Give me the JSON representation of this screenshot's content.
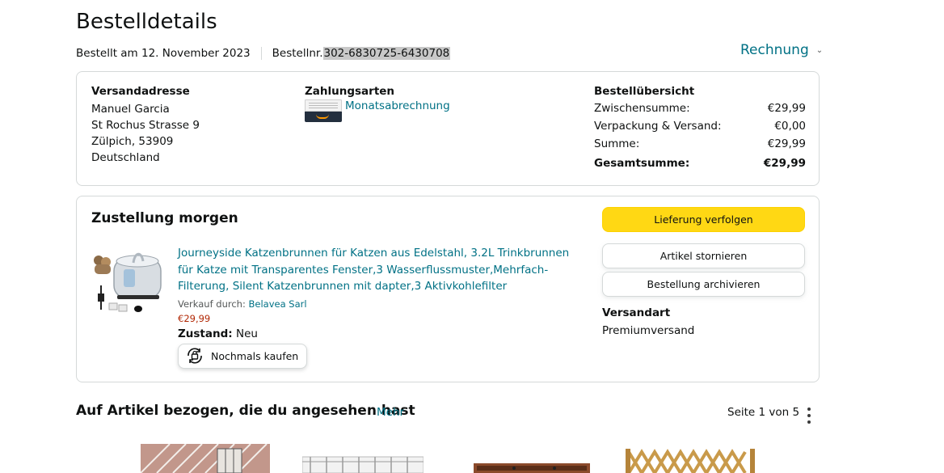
{
  "header": {
    "title": "Bestelldetails",
    "ordered_on": "Bestellt am 12. November 2023",
    "order_number_label": "Bestellnr.",
    "order_number": "302-6830725-6430708",
    "invoice_label": "Rechnung"
  },
  "summary": {
    "shipping_address": {
      "title": "Versandadresse",
      "lines": [
        "Manuel Garcia",
        "St Rochus Strasse 9",
        "Zülpich, 53909",
        "Deutschland"
      ]
    },
    "payment": {
      "title": "Zahlungsarten",
      "method": "Monatsabrechnung"
    },
    "overview": {
      "title": "Bestellübersicht",
      "rows": [
        {
          "label": "Zwischensumme:",
          "value": "€29,99"
        },
        {
          "label": "Verpackung & Versand:",
          "value": "€0,00"
        },
        {
          "label": "Summe:",
          "value": "€29,99"
        }
      ],
      "total_label": "Gesamtsumme:",
      "total_value": "€29,99"
    }
  },
  "delivery": {
    "title": "Zustellung morgen",
    "product": {
      "title": "Journeyside Katzenbrunnen für Katzen aus Edelstahl, 3.2L Trinkbrunnen für Katze mit Transparentes Fenster,3 Wasserflussmuster,Mehrfach-Filterung, Silent Katzenbrunnen mit dapter,3 Aktivkohlefilter",
      "seller_label": "Verkauf durch:",
      "seller": "Belavea Sarl",
      "price": "€29,99",
      "condition_label": "Zustand:",
      "condition": "Neu",
      "buy_again": "Nochmals kaufen"
    },
    "actions": {
      "track": "Lieferung verfolgen",
      "cancel": "Artikel stornieren",
      "archive": "Bestellung archivieren"
    },
    "shipping_type_label": "Versandart",
    "shipping_type": "Premiumversand"
  },
  "related": {
    "title": "Auf Artikel bezogen, die du angesehen hast",
    "more": "Mehr",
    "pager": "Seite 1 von 5"
  },
  "colors": {
    "link": "#007185",
    "primary_button": "#ffd814",
    "price": "#b12704",
    "border": "#d5d9d9"
  }
}
